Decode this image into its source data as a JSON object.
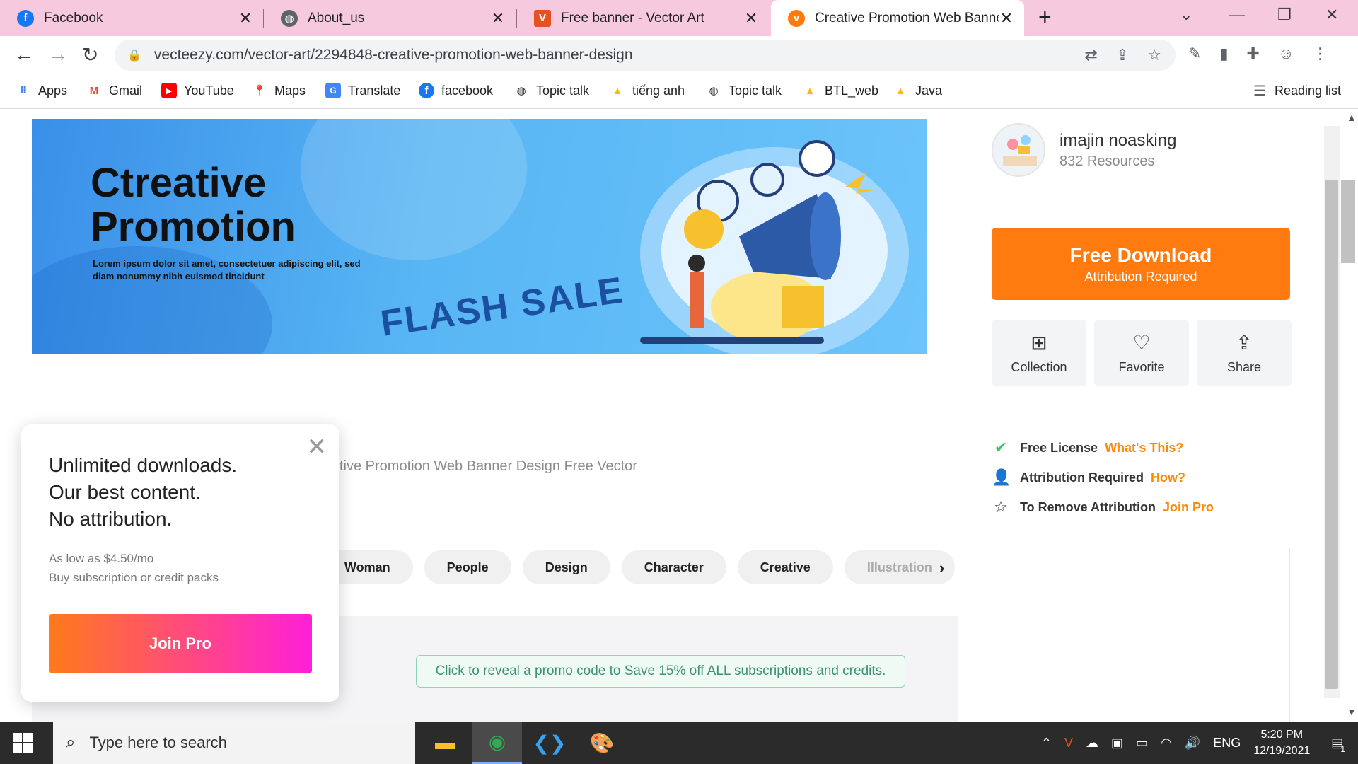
{
  "browser": {
    "tabs": [
      {
        "label": "Facebook",
        "favicon": "facebook-icon",
        "color": "#1877f2",
        "active": false
      },
      {
        "label": "About_us",
        "favicon": "globe-icon",
        "color": "#5f6368",
        "active": false
      },
      {
        "label": "Free banner - Vector Art",
        "favicon": "vecteezy-v-icon",
        "color": "#e8501d",
        "active": false
      },
      {
        "label": "Creative Promotion Web Banner",
        "favicon": "vecteezy-icon",
        "color": "#ff7a0f",
        "active": true
      }
    ],
    "url": "vecteezy.com/vector-art/2294848-creative-promotion-web-banner-design",
    "bookmarks": [
      {
        "label": "Apps",
        "icon": "apps-grid-icon"
      },
      {
        "label": "Gmail",
        "icon": "gmail-icon"
      },
      {
        "label": "YouTube",
        "icon": "youtube-icon"
      },
      {
        "label": "Maps",
        "icon": "maps-pin-icon"
      },
      {
        "label": "Translate",
        "icon": "translate-icon"
      },
      {
        "label": "facebook",
        "icon": "facebook-icon"
      },
      {
        "label": "Topic talk",
        "icon": "globe-icon"
      },
      {
        "label": "tiếng anh",
        "icon": "drive-icon"
      },
      {
        "label": "Topic talk",
        "icon": "globe-icon"
      },
      {
        "label": "BTL_web",
        "icon": "drive-icon"
      },
      {
        "label": "Java",
        "icon": "drive-icon"
      }
    ],
    "reading_list": "Reading list"
  },
  "banner": {
    "title_line1": "Ctreative",
    "title_line2": "Promotion",
    "subtitle_line1": "Lorem ipsum dolor sit amet, consectetuer adipiscing elit, sed",
    "subtitle_line2": "diam nonummy nibh euismod tincidunt",
    "flash": "FLASH SALE"
  },
  "caption": "tive Promotion Web Banner Design Free Vector",
  "tags": [
    "Woman",
    "People",
    "Design",
    "Character",
    "Creative",
    "Illustration"
  ],
  "promo_text": "Click to reveal a promo code to Save 15% off ALL subscriptions and credits.",
  "author": {
    "name": "imajin noasking",
    "resources": "832 Resources"
  },
  "download": {
    "label": "Free Download",
    "sublabel": "Attribution Required"
  },
  "actions": [
    {
      "label": "Collection",
      "icon": "collection-add-icon"
    },
    {
      "label": "Favorite",
      "icon": "heart-icon"
    },
    {
      "label": "Share",
      "icon": "share-icon"
    }
  ],
  "license": [
    {
      "label": "Free License",
      "link": "What's This?",
      "icon": "check-icon"
    },
    {
      "label": "Attribution Required",
      "link": "How?",
      "icon": "user-check-icon"
    },
    {
      "label": "To Remove Attribution",
      "link": "Join Pro",
      "icon": "star-icon"
    }
  ],
  "popup": {
    "line1": "Unlimited downloads.",
    "line2": "Our best content.",
    "line3": "No attribution.",
    "price": "As low as $4.50/mo",
    "price_sub": "Buy subscription or credit packs",
    "button": "Join Pro"
  },
  "taskbar": {
    "search_placeholder": "Type here to search",
    "language": "ENG",
    "time": "5:20 PM",
    "date": "12/19/2021",
    "notification_count": "1"
  },
  "colors": {
    "accent": "#ff7a0f",
    "link": "#ff8800",
    "promo_green": "#3b9370"
  }
}
